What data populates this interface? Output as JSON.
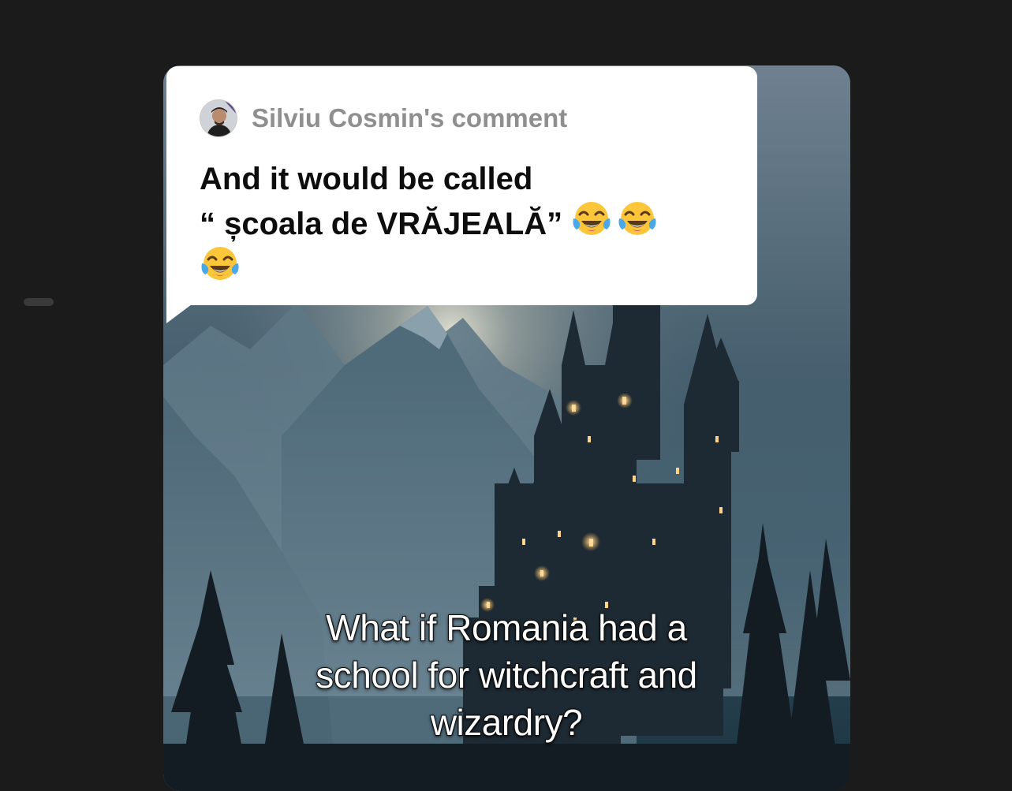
{
  "comment": {
    "author_label": "Silviu Cosmin's comment",
    "line1": "And it would be called",
    "line2": "“ școala de VRĂJEALĂ”",
    "emoji_name": "face-with-tears-of-joy",
    "emoji_count": 3
  },
  "video": {
    "caption_line1": "What if Romania had a",
    "caption_line2": "school for witchcraft and",
    "caption_line3": "wizardry?"
  },
  "colors": {
    "page_background": "#1b1b1b",
    "bubble_background": "#ffffff",
    "author_text": "#8f8f8f",
    "comment_text": "#0d0d0d",
    "caption_text": "#ffffff",
    "caption_outline": "#111111"
  }
}
